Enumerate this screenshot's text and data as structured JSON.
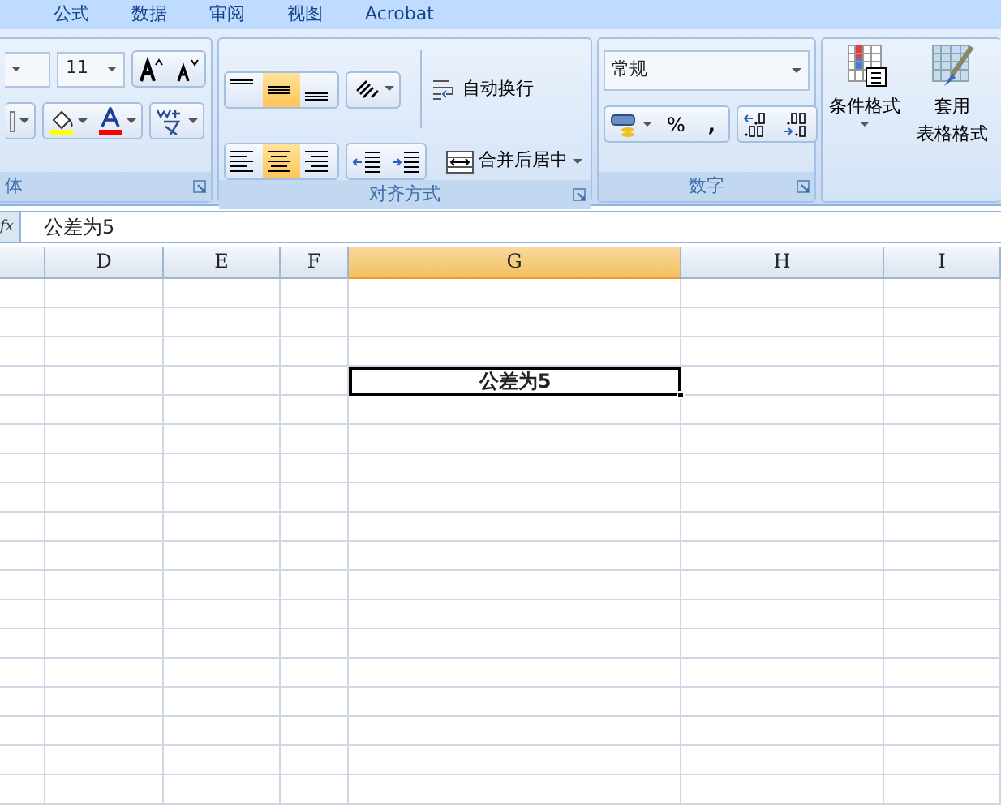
{
  "menu_tabs": [
    {
      "label": "公式",
      "selected": false
    },
    {
      "label": "数据",
      "selected": false
    },
    {
      "label": "审阅",
      "selected": false
    },
    {
      "label": "视图",
      "selected": false
    },
    {
      "label": "Acrobat",
      "selected": false
    }
  ],
  "font_group": {
    "font_size": "11",
    "label": "体"
  },
  "alignment_group": {
    "vertical": [
      {
        "kind": "top",
        "selected": false
      },
      {
        "kind": "middle",
        "selected": true
      },
      {
        "kind": "bottom",
        "selected": false
      }
    ],
    "horizontal": [
      {
        "kind": "left",
        "selected": false
      },
      {
        "kind": "center",
        "selected": true
      },
      {
        "kind": "right",
        "selected": false
      }
    ],
    "wrap_text": "自动换行",
    "merge_center": "合并后居中",
    "label": "对齐方式"
  },
  "number_group": {
    "format": "常规",
    "percent": "%",
    "comma": ",",
    "label": "数字"
  },
  "styles_group": {
    "conditional_format": "条件格式",
    "table_format_line1": "套用",
    "table_format_line2": "表格格式"
  },
  "formula_bar": {
    "fx": "fx",
    "content": "公差为5"
  },
  "columns": [
    {
      "label": "D",
      "selected": false
    },
    {
      "label": "E",
      "selected": false
    },
    {
      "label": "F",
      "selected": false
    },
    {
      "label": "G",
      "selected": true
    },
    {
      "label": "H",
      "selected": false
    },
    {
      "label": "I",
      "selected": false
    }
  ],
  "rows": [
    {
      "active": false
    },
    {
      "active": false
    },
    {
      "active": false
    },
    {
      "active": true,
      "text": "公差为5"
    },
    {
      "active": false
    },
    {
      "active": false
    },
    {
      "active": false
    },
    {
      "active": false
    },
    {
      "active": false
    },
    {
      "active": false
    },
    {
      "active": false
    },
    {
      "active": false
    },
    {
      "active": false
    },
    {
      "active": false
    },
    {
      "active": false
    },
    {
      "active": false
    },
    {
      "active": false
    },
    {
      "active": false
    }
  ]
}
